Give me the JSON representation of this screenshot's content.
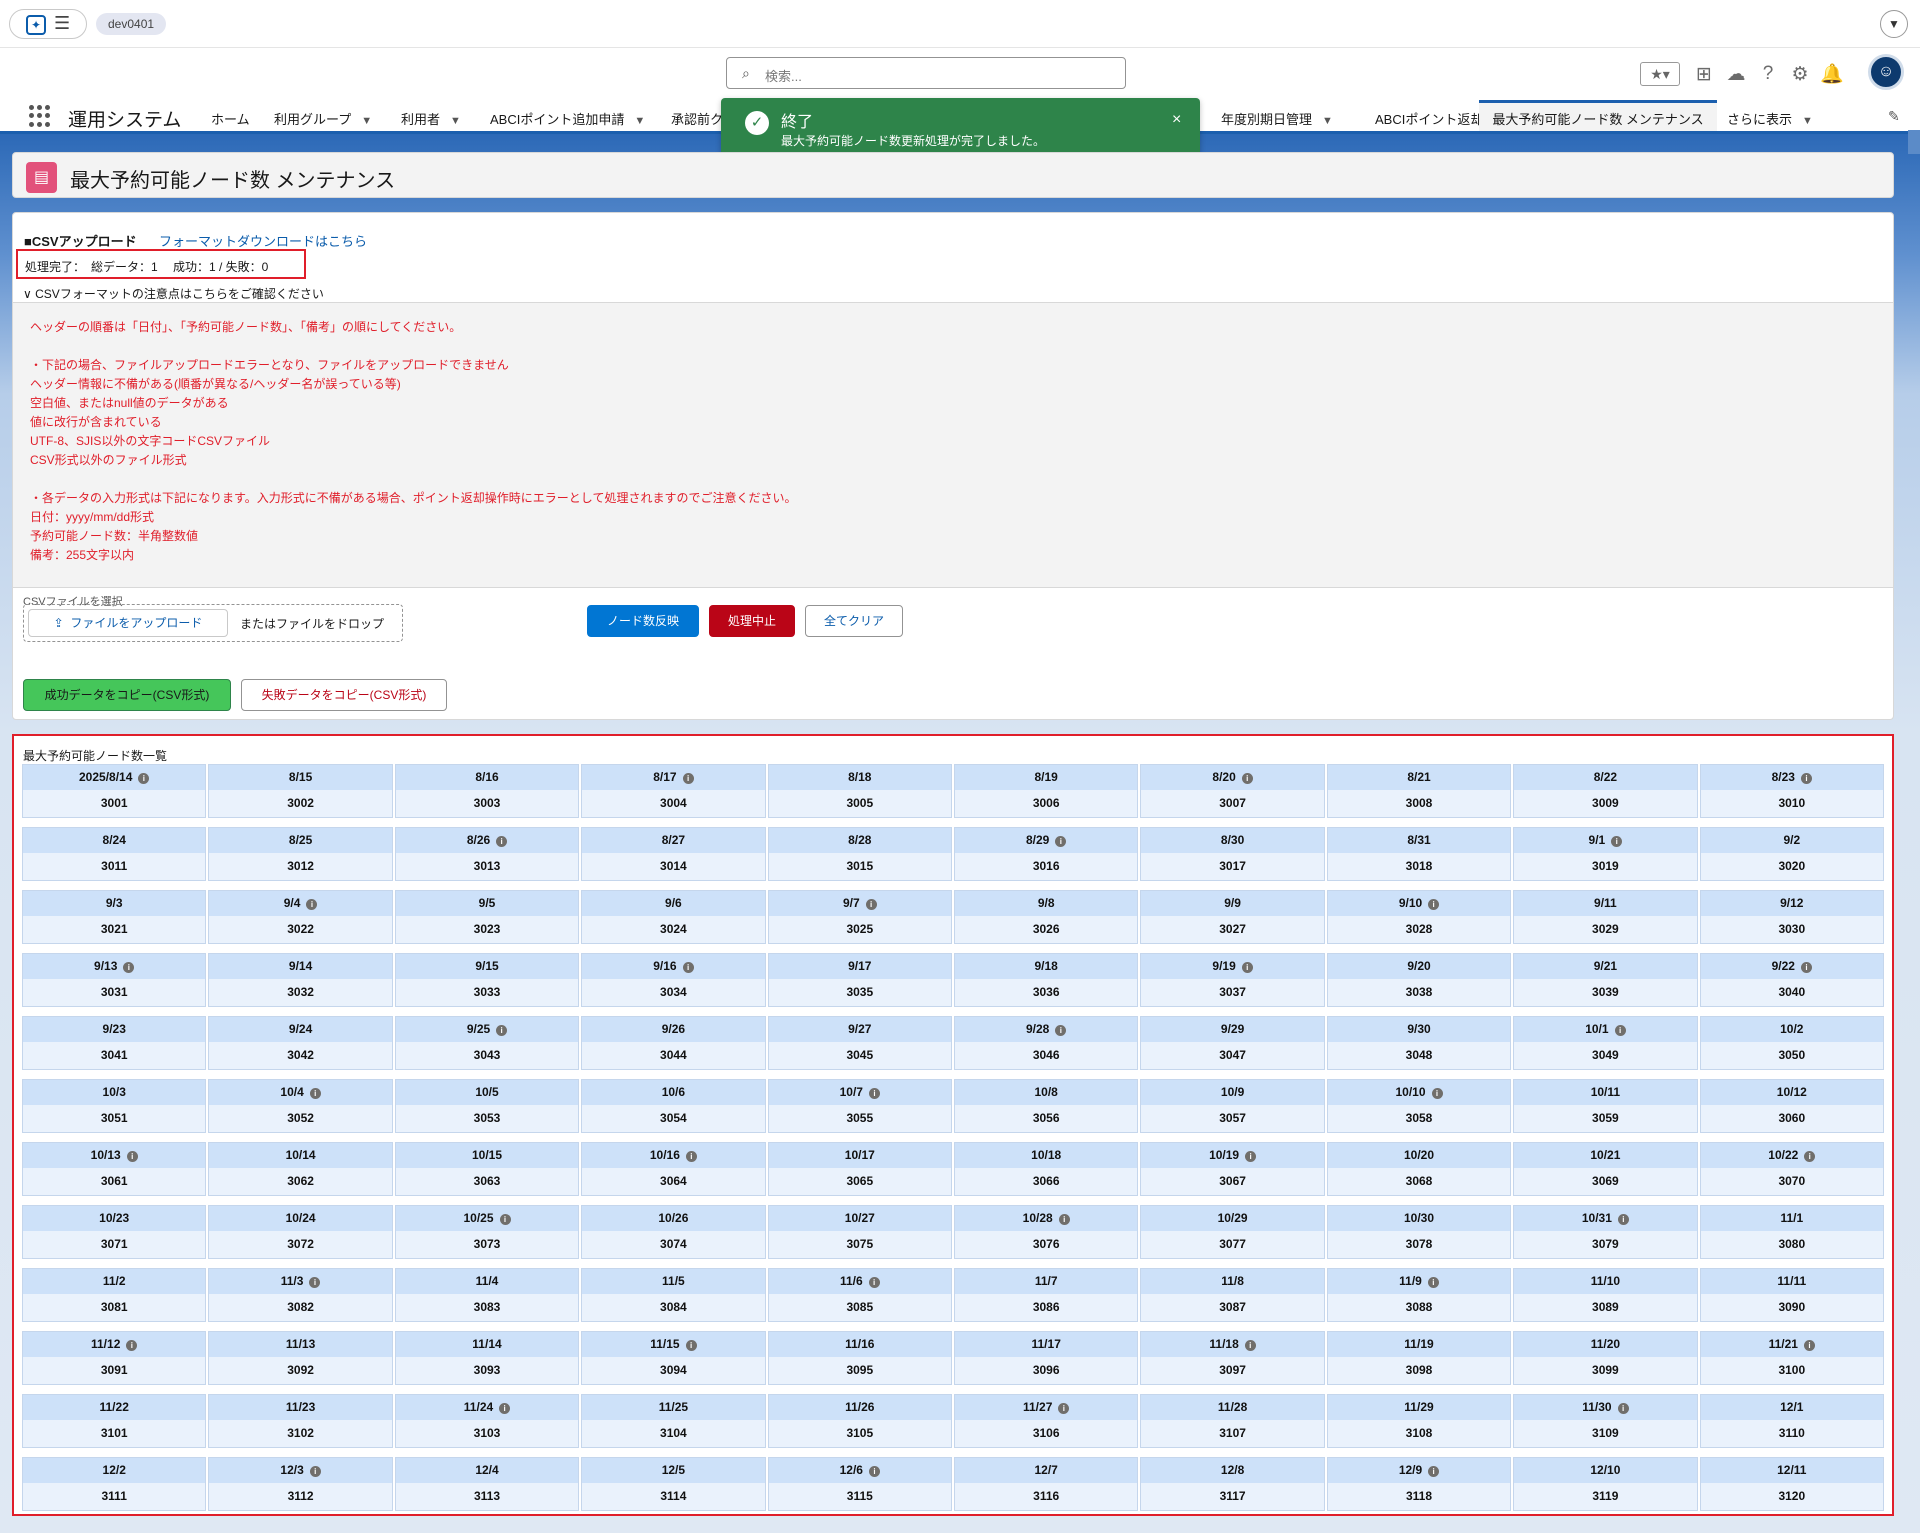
{
  "topbar": {
    "org": "dev0401"
  },
  "header": {
    "search_placeholder": "検索..."
  },
  "nav": {
    "app_name": "運用システム",
    "items": [
      {
        "label": "ホーム",
        "chevron": false
      },
      {
        "label": "利用グループ",
        "chevron": true
      },
      {
        "label": "利用者",
        "chevron": true
      },
      {
        "label": "ABCIポイント追加申請",
        "chevron": true
      },
      {
        "label": "承認前ク",
        "chevron": false
      },
      {
        "label": "年度別期日管理",
        "chevron": true
      },
      {
        "label": "ABCIポイント返却",
        "chevron": false
      }
    ],
    "active": "最大予約可能ノード数 メンテナンス",
    "more": "さらに表示"
  },
  "toast": {
    "title": "終了",
    "message": "最大予約可能ノード数更新処理が完了しました。",
    "close": "×"
  },
  "page": {
    "title": "最大予約可能ノード数 メンテナンス"
  },
  "upload": {
    "section_title": "■CSVアップロード",
    "format_link": "フォーマットダウンロードはこちら",
    "status": "処理完了：　総データ：1　 成功：1 / 失敗：0",
    "notes_toggle": "CSVフォーマットの注意点はこちらをご確認ください",
    "notes": {
      "header_order": "ヘッダーの順番は「日付」、「予約可能ノード数」、「備考」の順にしてください。",
      "error_intro": "・下記の場合、ファイルアップロードエラーとなり、ファイルをアップロードできません",
      "errors": [
        "ヘッダー情報に不備がある(順番が異なる/ヘッダー名が誤っている等)",
        "空白値、またはnull値のデータがある",
        "値に改行が含まれている",
        "UTF-8、SJIS以外の文字コードCSVファイル",
        "CSV形式以外のファイル形式"
      ],
      "format_intro": "・各データの入力形式は下記になります。入力形式に不備がある場合、ポイント返却操作時にエラーとして処理されますのでご注意ください。",
      "formats": [
        "日付：yyyy/mm/dd形式",
        "予約可能ノード数：半角整数値",
        "備考：255文字以内"
      ]
    },
    "file_label": "CSVファイルを選択",
    "upload_button": "ファイルをアップロード",
    "drop_text": "またはファイルをドロップ",
    "apply_button": "ノード数反映",
    "abort_button": "処理中止",
    "clear_button": "全てクリア",
    "copy_success_button": "成功データをコピー(CSV形式)",
    "copy_fail_button": "失敗データをコピー(CSV形式)"
  },
  "list": {
    "title": "最大予約可能ノード数一覧",
    "items": [
      {
        "date": "2025/8/14",
        "value": "3001",
        "info": true
      },
      {
        "date": "8/15",
        "value": "3002",
        "info": false
      },
      {
        "date": "8/16",
        "value": "3003",
        "info": false
      },
      {
        "date": "8/17",
        "value": "3004",
        "info": true
      },
      {
        "date": "8/18",
        "value": "3005",
        "info": false
      },
      {
        "date": "8/19",
        "value": "3006",
        "info": false
      },
      {
        "date": "8/20",
        "value": "3007",
        "info": true
      },
      {
        "date": "8/21",
        "value": "3008",
        "info": false
      },
      {
        "date": "8/22",
        "value": "3009",
        "info": false
      },
      {
        "date": "8/23",
        "value": "3010",
        "info": true
      },
      {
        "date": "8/24",
        "value": "3011",
        "info": false
      },
      {
        "date": "8/25",
        "value": "3012",
        "info": false
      },
      {
        "date": "8/26",
        "value": "3013",
        "info": true
      },
      {
        "date": "8/27",
        "value": "3014",
        "info": false
      },
      {
        "date": "8/28",
        "value": "3015",
        "info": false
      },
      {
        "date": "8/29",
        "value": "3016",
        "info": true
      },
      {
        "date": "8/30",
        "value": "3017",
        "info": false
      },
      {
        "date": "8/31",
        "value": "3018",
        "info": false
      },
      {
        "date": "9/1",
        "value": "3019",
        "info": true
      },
      {
        "date": "9/2",
        "value": "3020",
        "info": false
      },
      {
        "date": "9/3",
        "value": "3021",
        "info": false
      },
      {
        "date": "9/4",
        "value": "3022",
        "info": true
      },
      {
        "date": "9/5",
        "value": "3023",
        "info": false
      },
      {
        "date": "9/6",
        "value": "3024",
        "info": false
      },
      {
        "date": "9/7",
        "value": "3025",
        "info": true
      },
      {
        "date": "9/8",
        "value": "3026",
        "info": false
      },
      {
        "date": "9/9",
        "value": "3027",
        "info": false
      },
      {
        "date": "9/10",
        "value": "3028",
        "info": true
      },
      {
        "date": "9/11",
        "value": "3029",
        "info": false
      },
      {
        "date": "9/12",
        "value": "3030",
        "info": false
      },
      {
        "date": "9/13",
        "value": "3031",
        "info": true
      },
      {
        "date": "9/14",
        "value": "3032",
        "info": false
      },
      {
        "date": "9/15",
        "value": "3033",
        "info": false
      },
      {
        "date": "9/16",
        "value": "3034",
        "info": true
      },
      {
        "date": "9/17",
        "value": "3035",
        "info": false
      },
      {
        "date": "9/18",
        "value": "3036",
        "info": false
      },
      {
        "date": "9/19",
        "value": "3037",
        "info": true
      },
      {
        "date": "9/20",
        "value": "3038",
        "info": false
      },
      {
        "date": "9/21",
        "value": "3039",
        "info": false
      },
      {
        "date": "9/22",
        "value": "3040",
        "info": true
      },
      {
        "date": "9/23",
        "value": "3041",
        "info": false
      },
      {
        "date": "9/24",
        "value": "3042",
        "info": false
      },
      {
        "date": "9/25",
        "value": "3043",
        "info": true
      },
      {
        "date": "9/26",
        "value": "3044",
        "info": false
      },
      {
        "date": "9/27",
        "value": "3045",
        "info": false
      },
      {
        "date": "9/28",
        "value": "3046",
        "info": true
      },
      {
        "date": "9/29",
        "value": "3047",
        "info": false
      },
      {
        "date": "9/30",
        "value": "3048",
        "info": false
      },
      {
        "date": "10/1",
        "value": "3049",
        "info": true
      },
      {
        "date": "10/2",
        "value": "3050",
        "info": false
      },
      {
        "date": "10/3",
        "value": "3051",
        "info": false
      },
      {
        "date": "10/4",
        "value": "3052",
        "info": true
      },
      {
        "date": "10/5",
        "value": "3053",
        "info": false
      },
      {
        "date": "10/6",
        "value": "3054",
        "info": false
      },
      {
        "date": "10/7",
        "value": "3055",
        "info": true
      },
      {
        "date": "10/8",
        "value": "3056",
        "info": false
      },
      {
        "date": "10/9",
        "value": "3057",
        "info": false
      },
      {
        "date": "10/10",
        "value": "3058",
        "info": true
      },
      {
        "date": "10/11",
        "value": "3059",
        "info": false
      },
      {
        "date": "10/12",
        "value": "3060",
        "info": false
      },
      {
        "date": "10/13",
        "value": "3061",
        "info": true
      },
      {
        "date": "10/14",
        "value": "3062",
        "info": false
      },
      {
        "date": "10/15",
        "value": "3063",
        "info": false
      },
      {
        "date": "10/16",
        "value": "3064",
        "info": true
      },
      {
        "date": "10/17",
        "value": "3065",
        "info": false
      },
      {
        "date": "10/18",
        "value": "3066",
        "info": false
      },
      {
        "date": "10/19",
        "value": "3067",
        "info": true
      },
      {
        "date": "10/20",
        "value": "3068",
        "info": false
      },
      {
        "date": "10/21",
        "value": "3069",
        "info": false
      },
      {
        "date": "10/22",
        "value": "3070",
        "info": true
      },
      {
        "date": "10/23",
        "value": "3071",
        "info": false
      },
      {
        "date": "10/24",
        "value": "3072",
        "info": false
      },
      {
        "date": "10/25",
        "value": "3073",
        "info": true
      },
      {
        "date": "10/26",
        "value": "3074",
        "info": false
      },
      {
        "date": "10/27",
        "value": "3075",
        "info": false
      },
      {
        "date": "10/28",
        "value": "3076",
        "info": true
      },
      {
        "date": "10/29",
        "value": "3077",
        "info": false
      },
      {
        "date": "10/30",
        "value": "3078",
        "info": false
      },
      {
        "date": "10/31",
        "value": "3079",
        "info": true
      },
      {
        "date": "11/1",
        "value": "3080",
        "info": false
      },
      {
        "date": "11/2",
        "value": "3081",
        "info": false
      },
      {
        "date": "11/3",
        "value": "3082",
        "info": true
      },
      {
        "date": "11/4",
        "value": "3083",
        "info": false
      },
      {
        "date": "11/5",
        "value": "3084",
        "info": false
      },
      {
        "date": "11/6",
        "value": "3085",
        "info": true
      },
      {
        "date": "11/7",
        "value": "3086",
        "info": false
      },
      {
        "date": "11/8",
        "value": "3087",
        "info": false
      },
      {
        "date": "11/9",
        "value": "3088",
        "info": true
      },
      {
        "date": "11/10",
        "value": "3089",
        "info": false
      },
      {
        "date": "11/11",
        "value": "3090",
        "info": false
      },
      {
        "date": "11/12",
        "value": "3091",
        "info": true
      },
      {
        "date": "11/13",
        "value": "3092",
        "info": false
      },
      {
        "date": "11/14",
        "value": "3093",
        "info": false
      },
      {
        "date": "11/15",
        "value": "3094",
        "info": true
      },
      {
        "date": "11/16",
        "value": "3095",
        "info": false
      },
      {
        "date": "11/17",
        "value": "3096",
        "info": false
      },
      {
        "date": "11/18",
        "value": "3097",
        "info": true
      },
      {
        "date": "11/19",
        "value": "3098",
        "info": false
      },
      {
        "date": "11/20",
        "value": "3099",
        "info": false
      },
      {
        "date": "11/21",
        "value": "3100",
        "info": true
      },
      {
        "date": "11/22",
        "value": "3101",
        "info": false
      },
      {
        "date": "11/23",
        "value": "3102",
        "info": false
      },
      {
        "date": "11/24",
        "value": "3103",
        "info": true
      },
      {
        "date": "11/25",
        "value": "3104",
        "info": false
      },
      {
        "date": "11/26",
        "value": "3105",
        "info": false
      },
      {
        "date": "11/27",
        "value": "3106",
        "info": true
      },
      {
        "date": "11/28",
        "value": "3107",
        "info": false
      },
      {
        "date": "11/29",
        "value": "3108",
        "info": false
      },
      {
        "date": "11/30",
        "value": "3109",
        "info": true
      },
      {
        "date": "12/1",
        "value": "3110",
        "info": false
      },
      {
        "date": "12/2",
        "value": "3111",
        "info": false
      },
      {
        "date": "12/3",
        "value": "3112",
        "info": true
      },
      {
        "date": "12/4",
        "value": "3113",
        "info": false
      },
      {
        "date": "12/5",
        "value": "3114",
        "info": false
      },
      {
        "date": "12/6",
        "value": "3115",
        "info": true
      },
      {
        "date": "12/7",
        "value": "3116",
        "info": false
      },
      {
        "date": "12/8",
        "value": "3117",
        "info": false
      },
      {
        "date": "12/9",
        "value": "3118",
        "info": true
      },
      {
        "date": "12/10",
        "value": "3119",
        "info": false
      },
      {
        "date": "12/11",
        "value": "3120",
        "info": false
      }
    ]
  },
  "icons": {
    "info": "info-icon",
    "success": "check-circle-icon"
  },
  "colors": {
    "brand": "#0176d3",
    "toast_success": "#2e844a",
    "error": "#e01e2a",
    "date_header": "#cde1f9",
    "value_cell": "#eaf2fc"
  }
}
